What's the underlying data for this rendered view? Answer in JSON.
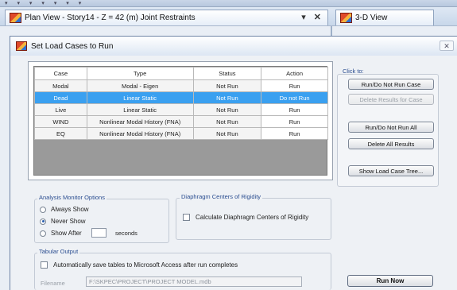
{
  "tabs": {
    "plan_view": "Plan View - Story14 - Z = 42 (m)  Joint Restraints",
    "view_3d": "3-D View",
    "pin_glyph": "▾",
    "close_glyph": "✕"
  },
  "dialog": {
    "title": "Set Load Cases to Run",
    "close_glyph": "✕",
    "table": {
      "columns": [
        "Case",
        "Type",
        "Status",
        "Action"
      ],
      "rows": [
        {
          "case": "Modal",
          "type": "Modal - Eigen",
          "status": "Not Run",
          "action": "Run",
          "selected": false
        },
        {
          "case": "Dead",
          "type": "Linear Static",
          "status": "Not Run",
          "action": "Do not Run",
          "selected": true
        },
        {
          "case": "Live",
          "type": "Linear Static",
          "status": "Not Run",
          "action": "Run",
          "selected": false
        },
        {
          "case": "WIND",
          "type": "Nonlinear Modal History (FNA)",
          "status": "Not Run",
          "action": "Run",
          "selected": false
        },
        {
          "case": "EQ",
          "type": "Nonlinear Modal History (FNA)",
          "status": "Not Run",
          "action": "Run",
          "selected": false
        }
      ]
    },
    "click_to": {
      "label": "Click to:",
      "run_do_not_run_case": "Run/Do Not Run Case",
      "delete_results_for_case": "Delete Results for Case",
      "run_do_not_run_all": "Run/Do Not Run All",
      "delete_all_results": "Delete All Results",
      "show_load_case_tree": "Show Load Case Tree..."
    },
    "analysis_monitor": {
      "title": "Analysis Monitor Options",
      "always_show": "Always Show",
      "never_show": "Never Show",
      "show_after": "Show After",
      "seconds": "seconds",
      "selected": "never_show"
    },
    "diaphragm": {
      "title": "Diaphragm Centers of Rigidity",
      "calculate": "Calculate Diaphragm Centers of Rigidity"
    },
    "tabular_output": {
      "title": "Tabular Output",
      "auto_save": "Automatically save tables to Microsoft Access after run completes",
      "filename_label": "Filename",
      "filename_value": "F:\\SKPEC\\PROJECT\\PROJECT MODEL.mdb"
    },
    "run_now": "Run Now"
  }
}
